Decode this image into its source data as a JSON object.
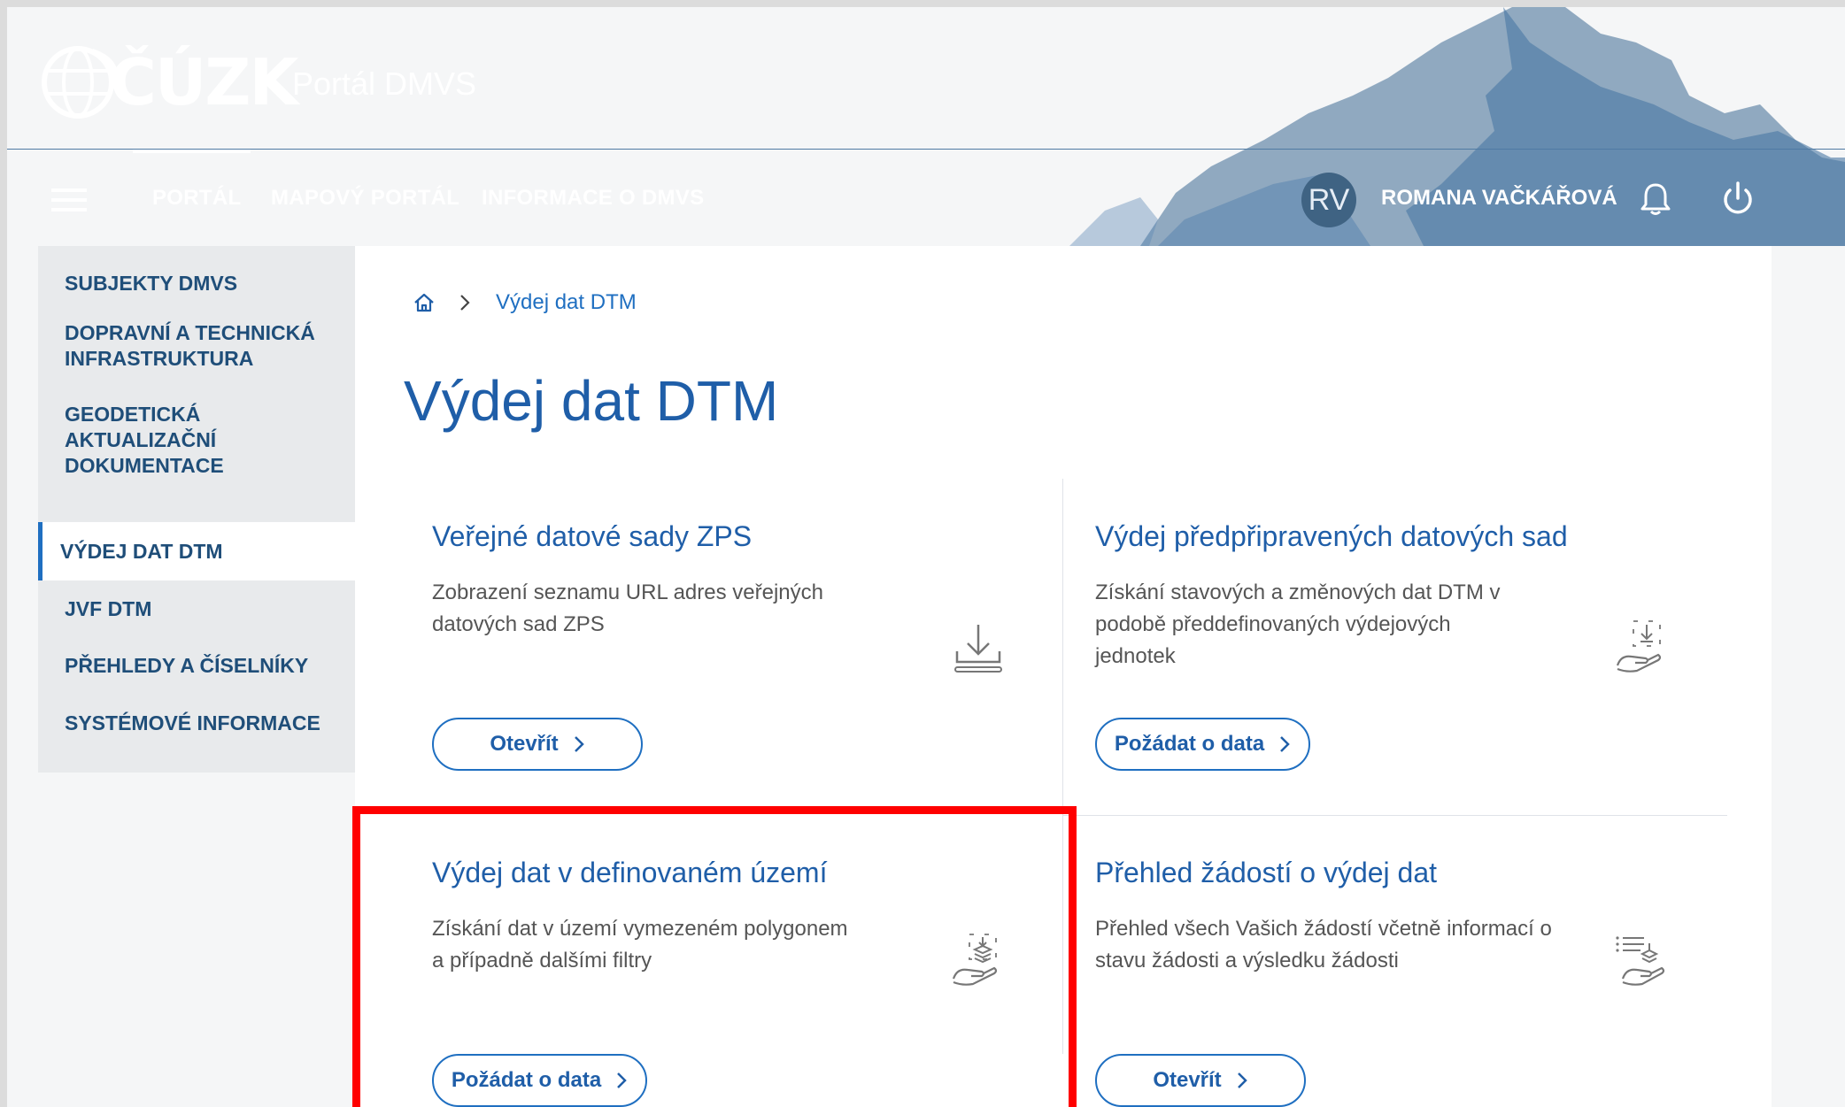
{
  "header": {
    "logo_text": "ČÚZK",
    "portal_title": "Portál DMVS",
    "nav": [
      {
        "label": "PORTÁL",
        "active": true
      },
      {
        "label": "MAPOVÝ PORTÁL",
        "active": false
      },
      {
        "label": "INFORMACE O DMVS",
        "active": false
      }
    ],
    "user": {
      "initials": "RV",
      "name": "ROMANA VAČKÁŘOVÁ"
    },
    "colors": {
      "header_bg": "#1f4e79",
      "accent": "#1f6fc1"
    }
  },
  "sidebar": {
    "items": [
      {
        "label": "SUBJEKTY DMVS",
        "active": false
      },
      {
        "label": "DOPRAVNÍ A TECHNICKÁ INFRASTRUKTURA",
        "active": false
      },
      {
        "label": "GEODETICKÁ AKTUALIZAČNÍ DOKUMENTACE",
        "active": false
      },
      {
        "label": "VÝDEJ DAT DTM",
        "active": true
      },
      {
        "label": "JVF DTM",
        "active": false
      },
      {
        "label": "PŘEHLEDY A ČÍSELNÍKY",
        "active": false
      },
      {
        "label": "SYSTÉMOVÉ INFORMACE",
        "active": false
      }
    ]
  },
  "breadcrumb": {
    "current": "Výdej dat DTM"
  },
  "page": {
    "title": "Výdej dat DTM"
  },
  "cards": [
    {
      "title": "Veřejné datové sady ZPS",
      "description": "Zobrazení seznamu URL adres veřejných datových sad ZPS",
      "icon": "download-icon",
      "button": "Otevřít"
    },
    {
      "title": "Výdej předpřipravených datových sad",
      "description": "Získání stavových a změnových dat DTM v podobě předdefinovaných výdejových jednotek",
      "icon": "hand-download-icon",
      "button": "Požádat o data"
    },
    {
      "title": "Výdej dat v definovaném území",
      "description": "Získání dat v území vymezeném polygonem a případně dalšími filtry",
      "icon": "hand-layers-icon",
      "button": "Požádat o data",
      "highlighted": true
    },
    {
      "title": "Přehled žádostí o výdej dat",
      "description": "Přehled všech Vašich žádostí včetně informací o stavu žádosti a výsledku žádosti",
      "icon": "hand-list-icon",
      "button": "Otevřít"
    }
  ],
  "highlight_color": "#ff0000"
}
